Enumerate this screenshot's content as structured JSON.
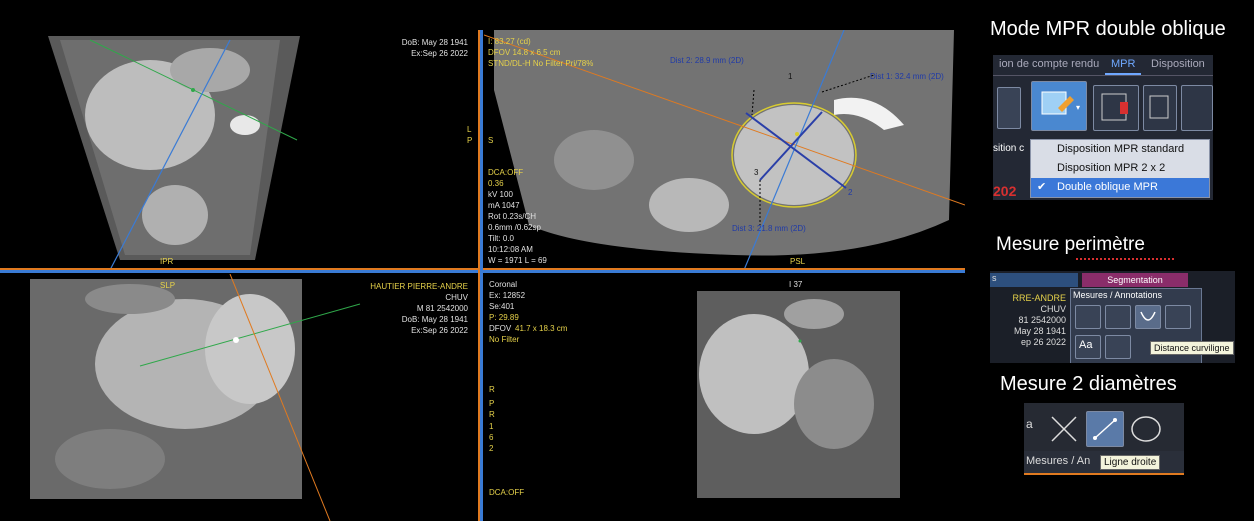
{
  "viewer": {
    "tl": {
      "dob": "DoB: May 28 1941",
      "exam": "Ex:Sep 26 2022",
      "ori_bottom": "IPR"
    },
    "tr": {
      "line1": "I: 83.27 (cd)",
      "line2": "DFOV 14.8 x 6.5 cm",
      "line3": "STND/DL-H No Filter Pri/78%",
      "dca": "DCA:OFF",
      "params": [
        "0.36",
        "kV 100",
        "mA 1047",
        "Rot 0.23s/CH",
        "0.6mm /0.62sp",
        "Tilt: 0.0",
        "10:12:08 AM"
      ],
      "wl": "W = 1971 L = 69",
      "ori_left": [
        "L",
        "P",
        "",
        "S"
      ],
      "ori_bottom": "PSL",
      "dist1": "Dist 1: 32.4 mm (2D)",
      "dist2": "Dist 2: 28.9 mm (2D)",
      "dist3": "Dist 3: 21.8 mm (2D)",
      "pt1": "1",
      "pt2": "2",
      "pt3": "3"
    },
    "bl": {
      "ori_top": "SLP",
      "patient": "HAUTIER PIERRE-ANDRE",
      "hospital": "CHUV",
      "id": "M 81 2542000",
      "dob": "DoB: May 28 1941",
      "exam": "Ex:Sep 26 2022"
    },
    "br": {
      "plane": "Coronal",
      "ex": "Ex: 12852",
      "se": "Se:401",
      "p": "P: 29.89",
      "dfov_label": "DFOV",
      "dfov_value": "41.7 x 18.3 cm",
      "filter": "No Filter",
      "ori_top": "I 37",
      "ori_left": [
        "R",
        "",
        "P",
        "R"
      ],
      "ori_left2": [
        "1",
        "6",
        "2"
      ],
      "dca": "DCA:OFF"
    }
  },
  "right_panel": {
    "section1": {
      "title": "Mode MPR double oblique",
      "tabs": [
        "ion de compte rendu",
        "MPR",
        "Disposition"
      ],
      "menu_items": [
        "Disposition MPR standard",
        "Disposition MPR 2 x 2",
        "Double oblique MPR"
      ],
      "menu_selected_index": 2,
      "partial_label": "sition c",
      "partial_red": "202"
    },
    "section2": {
      "title": "Mesure perimètre",
      "segmentation_label": "Segmentation",
      "panel_title": "Mesures / Annotations",
      "partial_s": "s",
      "patient_lines": [
        "RRE-ANDRE",
        "CHUV",
        "81 2542000",
        "May 28 1941",
        "ep 26 2022"
      ],
      "tooltip": "Distance curviligne",
      "aa_label": "Aa"
    },
    "section3": {
      "title": "Mesure 2 diamètres",
      "footer_label": "Mesures / An",
      "tooltip": "Ligne droite",
      "partial_a": "a"
    }
  }
}
